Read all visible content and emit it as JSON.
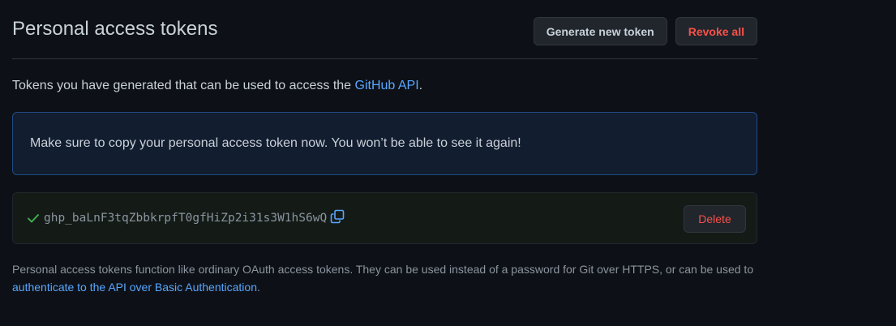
{
  "header": {
    "title": "Personal access tokens",
    "generate_label": "Generate new token",
    "revoke_label": "Revoke all"
  },
  "intro": {
    "text_before": "Tokens you have generated that can be used to access the ",
    "link_text": "GitHub API",
    "text_after": "."
  },
  "flash": {
    "message": "Make sure to copy your personal access token now. You won’t be able to see it again!"
  },
  "token": {
    "value": "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",
    "delete_label": "Delete",
    "status_icon": "check-icon",
    "copy_icon": "copy-icon"
  },
  "footnote": {
    "text_before": "Personal access tokens function like ordinary OAuth access tokens. They can be used instead of a password for Git over HTTPS, or can be used to ",
    "link_text": "authenticate to the API over Basic Authentication",
    "text_after": "."
  },
  "colors": {
    "background": "#0d1117",
    "link": "#58a6ff",
    "danger": "#f85149",
    "success": "#3fb950",
    "flash_bg": "#121d2f",
    "flash_border": "#1f4a85"
  }
}
